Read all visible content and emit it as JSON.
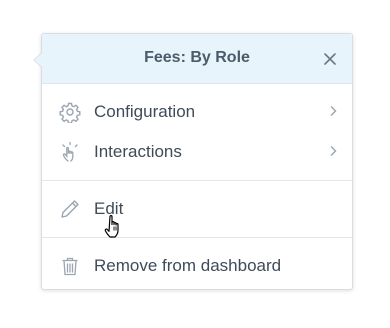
{
  "menu": {
    "title": "Fees: By Role",
    "close_icon": "close-icon",
    "sections": [
      {
        "items": [
          {
            "label": "Configuration",
            "icon": "gear-icon",
            "has_submenu": true
          },
          {
            "label": "Interactions",
            "icon": "tap-hand-icon",
            "has_submenu": true
          }
        ]
      },
      {
        "items": [
          {
            "label": "Edit",
            "icon": "pencil-icon",
            "has_submenu": false
          }
        ]
      },
      {
        "items": [
          {
            "label": "Remove from dashboard",
            "icon": "trash-icon",
            "has_submenu": false
          }
        ]
      }
    ]
  },
  "cursor": "hand-pointer-cursor",
  "colors": {
    "header_bg": "#e8f4fb",
    "text": "#3e4c59",
    "icon": "#9aa5b1",
    "border": "#d7dde3"
  }
}
